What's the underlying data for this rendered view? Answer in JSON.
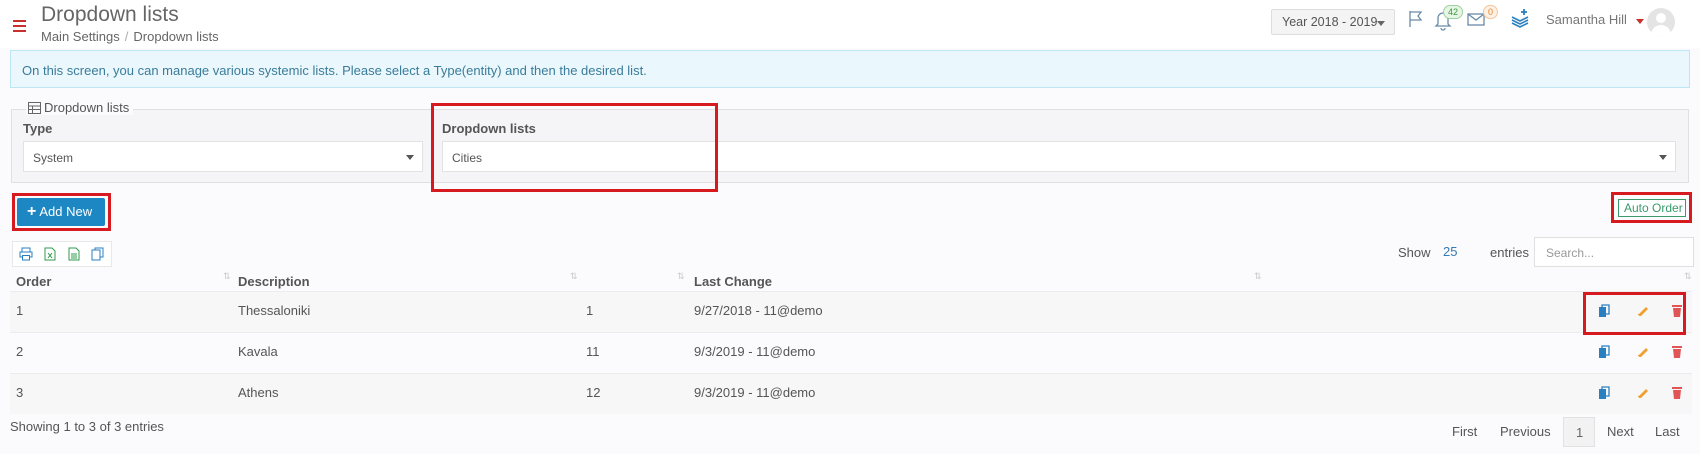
{
  "header": {
    "title": "Dropdown lists",
    "breadcrumb": [
      "Main Settings",
      "Dropdown lists"
    ],
    "breadcrumb_sep": "/",
    "year": "Year 2018 - 2019",
    "notifications_count": "42",
    "messages_count": "0",
    "user_name": "Samantha Hill"
  },
  "info_text": "On this screen, you can manage various systemic lists. Please select a Type(entity) and then the desired list.",
  "filter": {
    "legend": "Dropdown lists",
    "type_label": "Type",
    "type_value": "System",
    "list_label": "Dropdown lists",
    "list_value": "Cities"
  },
  "actions": {
    "add_new": "Add New",
    "auto_order": "Auto Order"
  },
  "table_controls": {
    "show_label": "Show",
    "page_size": "25",
    "entries_label": "entries",
    "search_placeholder": "Search..."
  },
  "table": {
    "columns": [
      "Order",
      "Description",
      "",
      "Last Change"
    ],
    "rows": [
      {
        "order": "1",
        "description": "Thessaloniki",
        "code": "1",
        "last_change": "9/27/2018 - 11@demo"
      },
      {
        "order": "2",
        "description": "Kavala",
        "code": "11",
        "last_change": "9/3/2019 - 11@demo"
      },
      {
        "order": "3",
        "description": "Athens",
        "code": "12",
        "last_change": "9/3/2019 - 11@demo"
      }
    ]
  },
  "footer": {
    "summary": "Showing 1 to 3 of 3 entries",
    "first": "First",
    "previous": "Previous",
    "current_page": "1",
    "next": "Next",
    "last": "Last"
  },
  "colors": {
    "primary_button": "#1d87c4",
    "highlight_box": "#d71920",
    "info_bg": "#eaf7fc",
    "copy_icon": "#2a7fc1",
    "edit_icon": "#f0a030",
    "delete_icon": "#e05555"
  }
}
